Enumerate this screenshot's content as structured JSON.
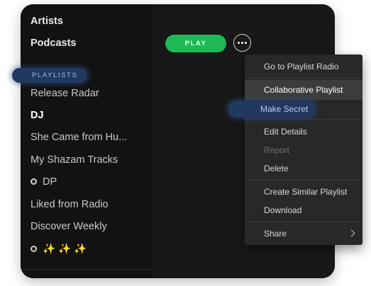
{
  "nav": {
    "artists": "Artists",
    "podcasts": "Podcasts",
    "playlists_header": "PLAYLISTS"
  },
  "playlists": [
    {
      "label": "Release Radar"
    },
    {
      "label": "DJ"
    },
    {
      "label": "She Came from Hu..."
    },
    {
      "label": "My Shazam Tracks"
    },
    {
      "label": "DP"
    },
    {
      "label": "Liked from Radio"
    },
    {
      "label": "Discover Weekly"
    },
    {
      "label": "✨ ✨ ✨"
    }
  ],
  "actions": {
    "play_label": "PLAY"
  },
  "context_menu": {
    "go_to_radio": "Go to Playlist Radio",
    "collaborative": "Collaborative Playlist",
    "make_secret": "Make Secret",
    "edit_details": "Edit Details",
    "report": "Report",
    "delete": "Delete",
    "create_similar": "Create Similar Playlist",
    "download": "Download",
    "share": "Share"
  },
  "colors": {
    "accent_green": "#1db954",
    "highlight_blue": "#22395f"
  }
}
